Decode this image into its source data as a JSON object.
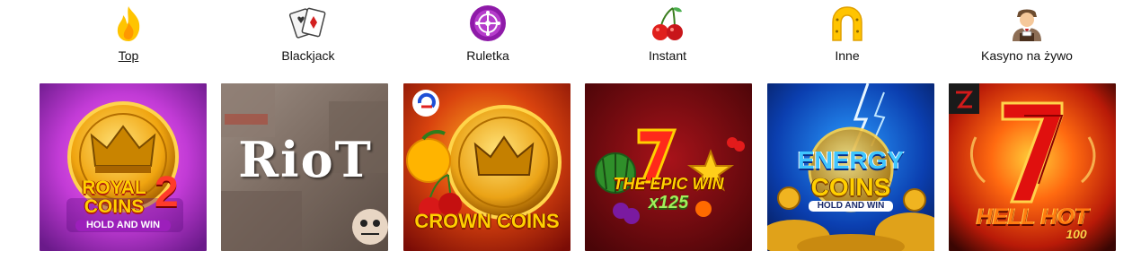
{
  "categories": [
    {
      "id": "top",
      "label": "Top",
      "icon": "flame-icon",
      "active": true
    },
    {
      "id": "blackjack",
      "label": "Blackjack",
      "icon": "playing-cards-icon",
      "active": false
    },
    {
      "id": "ruletka",
      "label": "Ruletka",
      "icon": "roulette-wheel-icon",
      "active": false
    },
    {
      "id": "instant",
      "label": "Instant",
      "icon": "cherries-icon",
      "active": false
    },
    {
      "id": "inne",
      "label": "Inne",
      "icon": "horseshoe-icon",
      "active": false
    },
    {
      "id": "live",
      "label": "Kasyno na żywo",
      "icon": "live-dealer-icon",
      "active": false
    }
  ],
  "games": [
    {
      "logo_line1": "ROYAL",
      "logo_line2": "COINS",
      "logo_number": "2",
      "tagline": "HOLD AND WIN"
    },
    {
      "logo": "RioT"
    },
    {
      "logo": "CROWN COINS"
    },
    {
      "logo_line1": "THE EPIC WIN",
      "logo_line2": "x125"
    },
    {
      "logo_line1": "ENERGY",
      "logo_line2": "COINS",
      "tagline": "HOLD AND WIN"
    },
    {
      "logo": "HELL HOT",
      "logo_number": "100"
    }
  ],
  "colors": {
    "accent_yellow": "#ffc400",
    "roulette_purple": "#8e1aa8",
    "cherry_red": "#e0201c",
    "text": "#111111"
  }
}
